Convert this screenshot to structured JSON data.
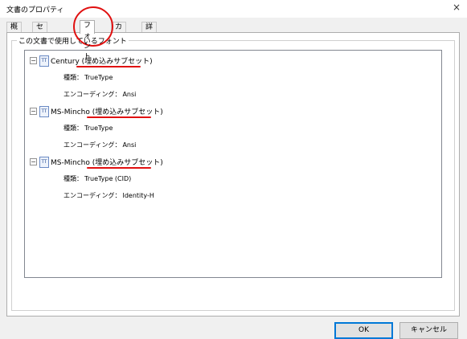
{
  "window": {
    "title": "文書のプロパティ"
  },
  "tabs": [
    {
      "label": "概要"
    },
    {
      "label": "セキュリティ"
    },
    {
      "label": "フォント"
    },
    {
      "label": "カスタム"
    },
    {
      "label": "詳細設定"
    }
  ],
  "group_label": "この文書で使用しているフォント",
  "fonts": [
    {
      "name": "Century (埋め込みサブセット)",
      "type_key": "種類：",
      "type_val": "TrueType",
      "enc_key": "エンコーディング：",
      "enc_val": "Ansi"
    },
    {
      "name": "MS-Mincho (埋め込みサブセット)",
      "type_key": "種類：",
      "type_val": "TrueType",
      "enc_key": "エンコーディング：",
      "enc_val": "Ansi"
    },
    {
      "name": "MS-Mincho (埋め込みサブセット)",
      "type_key": "種類：",
      "type_val": "TrueType (CID)",
      "enc_key": "エンコーディング：",
      "enc_val": "Identity-H"
    }
  ],
  "buttons": {
    "ok": "OK",
    "cancel": "キャンセル"
  },
  "colors": {
    "annotation": "#e01010",
    "ok_border": "#0078d7"
  },
  "icons": {
    "close": "×",
    "collapse": "−",
    "font": "TT"
  }
}
